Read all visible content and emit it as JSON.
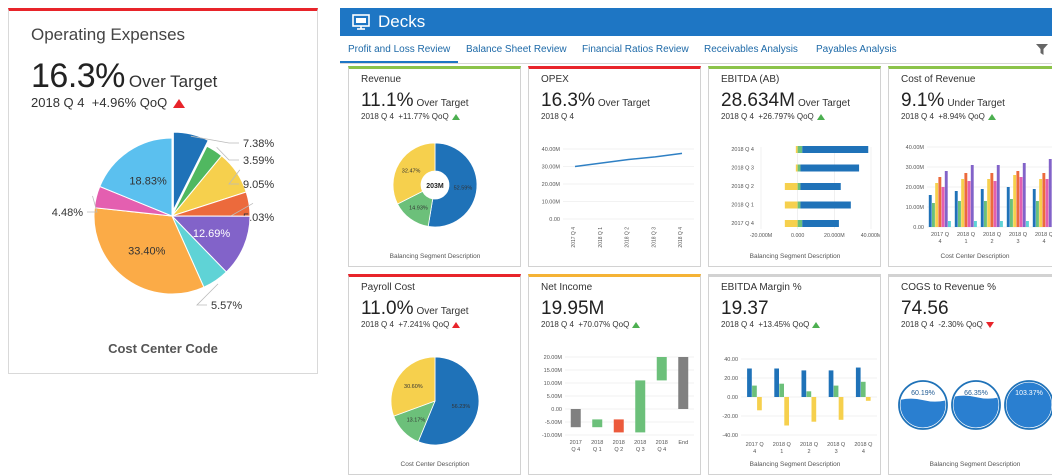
{
  "left_card": {
    "title": "Operating Expenses",
    "value": "16.3%",
    "status": "Over Target",
    "period": "2018 Q 4",
    "change": "+4.96% QoQ",
    "caption": "Cost Center Code",
    "trend": "up-red"
  },
  "header": {
    "title": "Decks",
    "icon": "presentation-icon"
  },
  "tabs": [
    {
      "label": "Profit and Loss Review",
      "active": true
    },
    {
      "label": "Balance Sheet Review"
    },
    {
      "label": "Financial Ratios Review"
    },
    {
      "label": "Receivables Analysis"
    },
    {
      "label": "Payables Analysis"
    }
  ],
  "cards": {
    "revenue": {
      "title": "Revenue",
      "value": "11.1%",
      "status": "Over Target",
      "period": "2018 Q 4",
      "change": "+11.77% QoQ",
      "caption": "Balancing Segment Description",
      "center_label": "203M",
      "trend": "up-green"
    },
    "opex": {
      "title": "OPEX",
      "value": "16.3%",
      "status": "Over Target",
      "period": "2018 Q 4"
    },
    "ebitda_ab": {
      "title": "EBITDA (AB)",
      "value": "28.634M",
      "status": "Over Target",
      "period": "2018 Q 4",
      "change": "+26.797% QoQ",
      "caption": "Balancing Segment Description",
      "trend": "up-green"
    },
    "cost_of_revenue": {
      "title": "Cost of Revenue",
      "value": "9.1%",
      "status": "Under Target",
      "period": "2018 Q 4",
      "change": "+8.94% QoQ",
      "caption": "Cost Center Description",
      "trend": "up-green"
    },
    "payroll_cost": {
      "title": "Payroll Cost",
      "value": "11.0%",
      "status": "Over Target",
      "period": "2018 Q 4",
      "change": "+7.241% QoQ",
      "caption": "Cost Center Description",
      "trend": "up-red"
    },
    "net_income": {
      "title": "Net Income",
      "value": "19.95M",
      "status": "",
      "period": "2018 Q 4",
      "change": "+70.07% QoQ",
      "trend": "up-green"
    },
    "ebitda_margin": {
      "title": "EBITDA Margin %",
      "value": "19.37",
      "status": "",
      "period": "2018 Q 4",
      "change": "+13.45% QoQ",
      "caption": "Balancing Segment Description",
      "trend": "up-green"
    },
    "cogs_to_revenue": {
      "title": "COGS to Revenue %",
      "value": "74.56",
      "status": "",
      "period": "2018 Q 4",
      "change": "-2.30% QoQ",
      "caption": "Balancing Segment Description",
      "trend": "down-red"
    }
  },
  "chart_data": [
    {
      "id": "operating_expenses",
      "type": "pie",
      "xlabel": "Cost Center Code",
      "slices": [
        {
          "value": 7.38,
          "label": "7.38%",
          "color": "#1f72b8"
        },
        {
          "value": 3.59,
          "label": "3.59%",
          "color": "#50b860"
        },
        {
          "value": 9.05,
          "label": "9.05%",
          "color": "#f6d04d"
        },
        {
          "value": 5.03,
          "label": "5.03%",
          "color": "#ec6a3c"
        },
        {
          "value": 12.69,
          "label": "12.69%",
          "color": "#8263c9"
        },
        {
          "value": 5.57,
          "label": "5.57%",
          "color": "#5fd3d6"
        },
        {
          "value": 33.4,
          "label": "33.40%",
          "color": "#fbab47"
        },
        {
          "value": 4.48,
          "label": "4.48%",
          "color": "#e45fb0"
        },
        {
          "value": 18.83,
          "label": "18.83%",
          "color": "#5bc0ef"
        }
      ]
    },
    {
      "id": "revenue",
      "type": "pie",
      "xlabel": "Balancing Segment Description",
      "center": "203M",
      "slices": [
        {
          "value": 52.59,
          "label": "52.59%",
          "color": "#1f72b8"
        },
        {
          "value": 14.93,
          "label": "14.93%",
          "color": "#6cc07a"
        },
        {
          "value": 32.47,
          "label": "32.47%",
          "color": "#f6d04d"
        }
      ]
    },
    {
      "id": "opex",
      "type": "line",
      "categories": [
        "2017 Q 4",
        "2018 Q 1",
        "2018 Q 2",
        "2018 Q 3",
        "2018 Q 4"
      ],
      "values": [
        30,
        32,
        34,
        35.5,
        37.5
      ],
      "ylim": [
        0,
        40
      ],
      "yticks": [
        "0.00",
        "10.00M",
        "20.00M",
        "30.00M",
        "40.00M"
      ]
    },
    {
      "id": "ebitda_ab",
      "type": "bar",
      "orientation": "horizontal",
      "xlabel": "Balancing Segment Description",
      "categories": [
        "2017 Q 4",
        "2018 Q 1",
        "2018 Q 2",
        "2018 Q 3",
        "2018 Q 4"
      ],
      "xlim": [
        -20,
        40
      ],
      "xticks": [
        "-20.000M",
        "0.000",
        "20.000M",
        "40.000M"
      ],
      "series": [
        {
          "color": "#f6d04d",
          "values": [
            -7,
            -7,
            -7,
            -1,
            -1
          ]
        },
        {
          "color": "#6cc07a",
          "values": [
            2.5,
            1.5,
            1.5,
            1.5,
            2.5
          ]
        },
        {
          "color": "#1f72b8",
          "values": [
            20,
            27.5,
            22,
            32,
            36
          ]
        }
      ]
    },
    {
      "id": "cost_of_revenue",
      "type": "bar",
      "xlabel": "Cost Center Description",
      "categories": [
        "2017 Q 4",
        "2018 Q 1",
        "2018 Q 2",
        "2018 Q 3",
        "2018 Q 4"
      ],
      "ylim": [
        0,
        40
      ],
      "yticks": [
        "0.00",
        "10.00M",
        "20.00M",
        "30.00M",
        "40.00M"
      ],
      "series": [
        {
          "color": "#1f72b8",
          "values": [
            16,
            18,
            19,
            20,
            19
          ]
        },
        {
          "color": "#6cc07a",
          "values": [
            12,
            13,
            13,
            14,
            13
          ]
        },
        {
          "color": "#f6d04d",
          "values": [
            22,
            24,
            24,
            26,
            24
          ]
        },
        {
          "color": "#ec6a3c",
          "values": [
            25,
            27,
            27,
            28,
            27
          ]
        },
        {
          "color": "#e45fb0",
          "values": [
            20,
            23,
            23,
            25,
            24
          ]
        },
        {
          "color": "#8263c9",
          "values": [
            28,
            31,
            31,
            32,
            34
          ]
        },
        {
          "color": "#5fd3d6",
          "values": [
            3,
            3,
            3,
            3,
            3
          ]
        }
      ]
    },
    {
      "id": "payroll_cost",
      "type": "pie",
      "xlabel": "Cost Center Description",
      "slices": [
        {
          "value": 56.23,
          "label": "56.23%",
          "color": "#1f72b8"
        },
        {
          "value": 13.17,
          "label": "13.17%",
          "color": "#6cc07a"
        },
        {
          "value": 30.6,
          "label": "30.60%",
          "color": "#f6d04d"
        }
      ]
    },
    {
      "id": "net_income",
      "type": "waterfall",
      "categories": [
        "2017 Q 4",
        "2018 Q 1",
        "2018 Q 2",
        "2018 Q 3",
        "2018 Q 4",
        "End"
      ],
      "ylim": [
        -10,
        20
      ],
      "yticks": [
        "-10.00M",
        "-5.00M",
        "0.00",
        "5.00M",
        "10.00M",
        "15.00M",
        "20.00M"
      ],
      "steps": [
        {
          "start": 0,
          "end": -7,
          "color": "#808080"
        },
        {
          "start": -7,
          "end": -4,
          "color": "#6cc07a"
        },
        {
          "start": -4,
          "end": -9,
          "color": "#ec5a3c"
        },
        {
          "start": -9,
          "end": 11,
          "color": "#6cc07a"
        },
        {
          "start": 11,
          "end": 20,
          "color": "#6cc07a"
        },
        {
          "start": 0,
          "end": 20,
          "color": "#808080"
        }
      ]
    },
    {
      "id": "ebitda_margin",
      "type": "bar",
      "xlabel": "Balancing Segment Description",
      "categories": [
        "2017 Q 4",
        "2018 Q 1",
        "2018 Q 2",
        "2018 Q 3",
        "2018 Q 4"
      ],
      "ylim": [
        -40,
        40
      ],
      "yticks": [
        "-40.00",
        "-20.00",
        "0.00",
        "20.00",
        "40.00"
      ],
      "series": [
        {
          "color": "#1f72b8",
          "values": [
            30,
            30,
            28,
            28,
            31
          ]
        },
        {
          "color": "#6cc07a",
          "values": [
            12,
            14,
            6,
            12,
            16
          ]
        },
        {
          "color": "#f6d04d",
          "values": [
            -14,
            -30,
            -26,
            -24,
            -4
          ]
        }
      ]
    },
    {
      "id": "cogs_to_revenue",
      "type": "gauge",
      "xlabel": "Balancing Segment Description",
      "items": [
        {
          "value": 60.19,
          "label": "60.19%"
        },
        {
          "value": 66.35,
          "label": "66.35%"
        },
        {
          "value": 103.37,
          "label": "103.37%"
        }
      ]
    }
  ]
}
